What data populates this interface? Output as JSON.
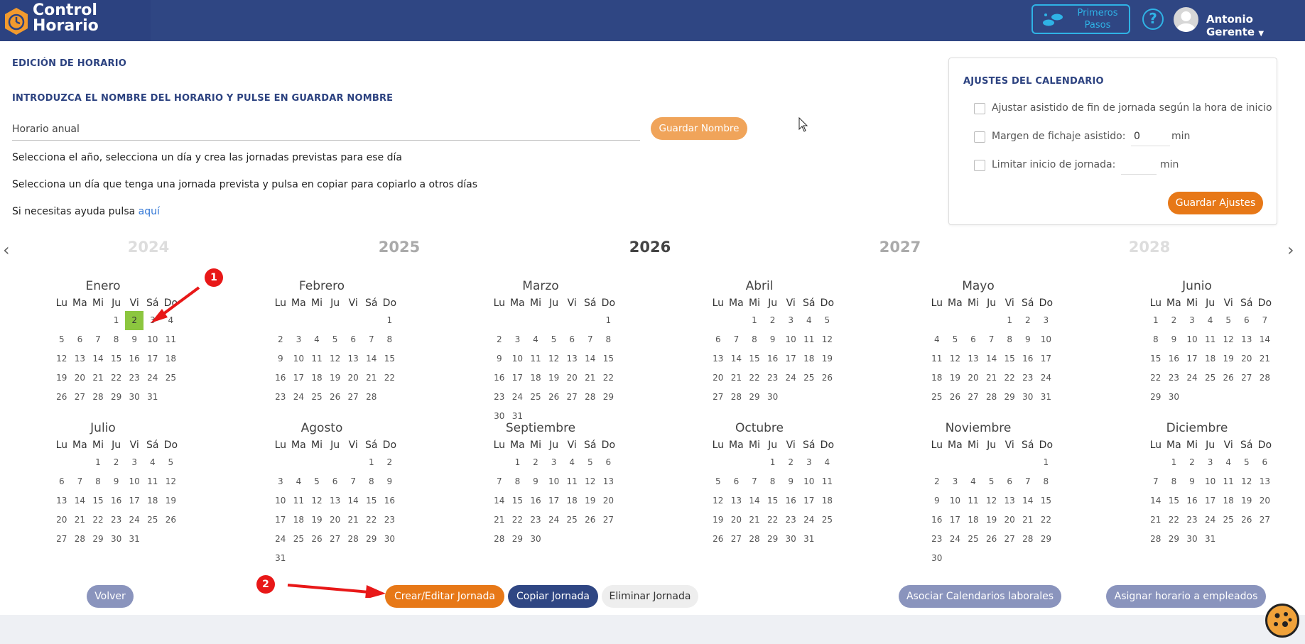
{
  "app": {
    "title_line1": "Control",
    "title_line2": "Horario"
  },
  "header": {
    "first_steps_line1": "Primeros",
    "first_steps_line2": "Pasos",
    "help_symbol": "?",
    "user_name": "Antonio Gerente"
  },
  "editor": {
    "section_title": "EDICIÓN DE HORARIO",
    "name_prompt": "INTRODUZCA EL NOMBRE DEL HORARIO Y PULSE EN GUARDAR NOMBRE",
    "name_value": "Horario anual",
    "save_name_label": "Guardar Nombre",
    "instruction1": "Selecciona el año, selecciona un día y crea las jornadas previstas para ese día",
    "instruction2": "Selecciona un día que tenga una jornada prevista y pulsa en copiar para copiarlo a otros días",
    "help_text": "Si necesitas ayuda pulsa",
    "help_link": "aquí"
  },
  "settings": {
    "title": "AJUSTES DEL CALENDARIO",
    "opt1": "Ajustar asistido de fin de jornada según la hora de inicio",
    "opt2": "Margen de fichaje asistido:",
    "opt2_value": "0",
    "opt2_unit": "min",
    "opt3": "Limitar inicio de jornada:",
    "opt3_value": "",
    "opt3_unit": "min",
    "save_label": "Guardar Ajustes"
  },
  "years": [
    "2024",
    "2025",
    "2026",
    "2027",
    "2028"
  ],
  "selected_year": "2026",
  "weekdays": [
    "Lu",
    "Ma",
    "Mi",
    "Ju",
    "Vi",
    "Sá",
    "Do"
  ],
  "months": [
    {
      "name": "Enero",
      "offset": 3,
      "days": 31,
      "selected": 2
    },
    {
      "name": "Febrero",
      "offset": 6,
      "days": 28
    },
    {
      "name": "Marzo",
      "offset": 6,
      "days": 31
    },
    {
      "name": "Abril",
      "offset": 2,
      "days": 30
    },
    {
      "name": "Mayo",
      "offset": 4,
      "days": 31
    },
    {
      "name": "Junio",
      "offset": 0,
      "days": 30
    },
    {
      "name": "Julio",
      "offset": 2,
      "days": 31
    },
    {
      "name": "Agosto",
      "offset": 5,
      "days": 31
    },
    {
      "name": "Septiembre",
      "offset": 1,
      "days": 30
    },
    {
      "name": "Octubre",
      "offset": 3,
      "days": 31
    },
    {
      "name": "Noviembre",
      "offset": 6,
      "days": 30
    },
    {
      "name": "Diciembre",
      "offset": 1,
      "days": 31
    }
  ],
  "annotations": {
    "badge1": "1",
    "badge2": "2"
  },
  "actions": {
    "back": "Volver",
    "create_edit": "Crear/Editar Jornada",
    "copy": "Copiar Jornada",
    "delete": "Eliminar Jornada",
    "assoc_calendars": "Asociar Calendarios laborales",
    "assign_employees": "Asignar horario a empleados"
  },
  "colors": {
    "primary": "#2f4683",
    "accent": "#e77817",
    "selected_day": "#8cc63f",
    "muted_button": "#8a94bd"
  }
}
